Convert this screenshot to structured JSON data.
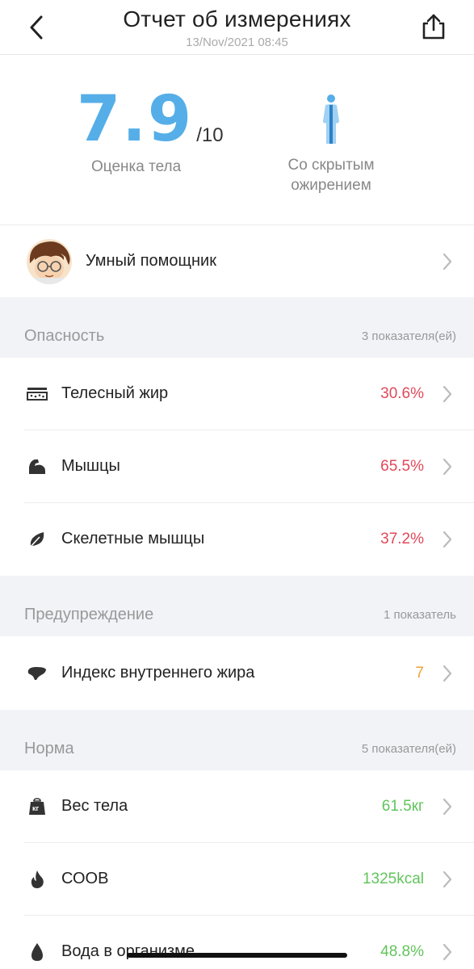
{
  "header": {
    "title": "Отчет об измерениях",
    "datetime": "13/Nov/2021 08:45",
    "back_icon": "chevron-left-icon",
    "share_icon": "share-icon"
  },
  "summary": {
    "score": "7.9",
    "score_max": "/10",
    "score_label": "Оценка тела",
    "body_type_icon": "body-figure-icon",
    "body_type_line1": "Со скрытым",
    "body_type_line2": "ожирением",
    "accent_color": "#55aee8"
  },
  "assistant": {
    "label": "Умный помощник",
    "avatar_icon": "assistant-avatar"
  },
  "sections": [
    {
      "title": "Опасность",
      "count": "3 показателя(ей)",
      "value_color": "#e0495a",
      "rows": [
        {
          "icon": "body-fat-icon",
          "label": "Телесный жир",
          "value": "30.6%"
        },
        {
          "icon": "muscle-icon",
          "label": "Мышцы",
          "value": "65.5%"
        },
        {
          "icon": "leaf-icon",
          "label": "Скелетные мышцы",
          "value": "37.2%"
        }
      ]
    },
    {
      "title": "Предупреждение",
      "count": "1 показатель",
      "value_color": "#f0a13a",
      "rows": [
        {
          "icon": "liver-icon",
          "label": "Индекс внутреннего жира",
          "value": "7"
        }
      ]
    },
    {
      "title": "Норма",
      "count": "5 показателя(ей)",
      "value_color": "#62c45c",
      "rows": [
        {
          "icon": "weight-icon",
          "label": "Вес тела",
          "value": "61.5кг"
        },
        {
          "icon": "flame-icon",
          "label": "СООВ",
          "value": "1325kcal"
        },
        {
          "icon": "water-drop-icon",
          "label": "Вода в организме",
          "value": "48.8%"
        }
      ]
    }
  ],
  "weight_icon_text": "кг"
}
